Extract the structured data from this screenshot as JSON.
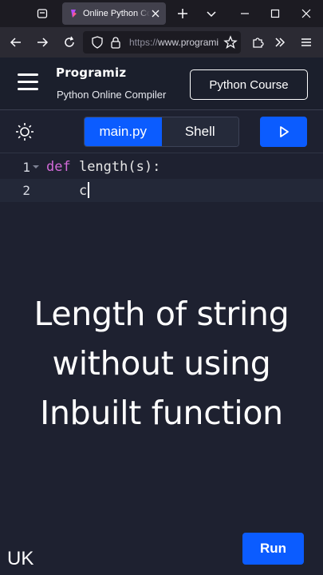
{
  "browser": {
    "tab_title": "Online Python Compiler",
    "url_scheme": "https://",
    "url_host": "www.programiz.com",
    "colors": {
      "tabstrip": "#1c1b22",
      "navbar": "#2b2a33",
      "active_tab": "#42414d"
    }
  },
  "site": {
    "logo_text": "Programiz",
    "subtitle": "Python Online Compiler",
    "course_button": "Python Course"
  },
  "toolbar": {
    "tabs": [
      {
        "label": "main.py",
        "active": true
      },
      {
        "label": "Shell",
        "active": false
      }
    ],
    "accent": "#0b5cff"
  },
  "editor": {
    "lines": [
      {
        "number": "1",
        "keyword": "def",
        "rest": " length(s):"
      },
      {
        "number": "2",
        "keyword": "",
        "rest": "    c"
      }
    ]
  },
  "caption": {
    "lines": [
      "Length of string",
      "without using",
      "Inbuilt function"
    ]
  },
  "run_button": "Run",
  "watermark": "UK"
}
